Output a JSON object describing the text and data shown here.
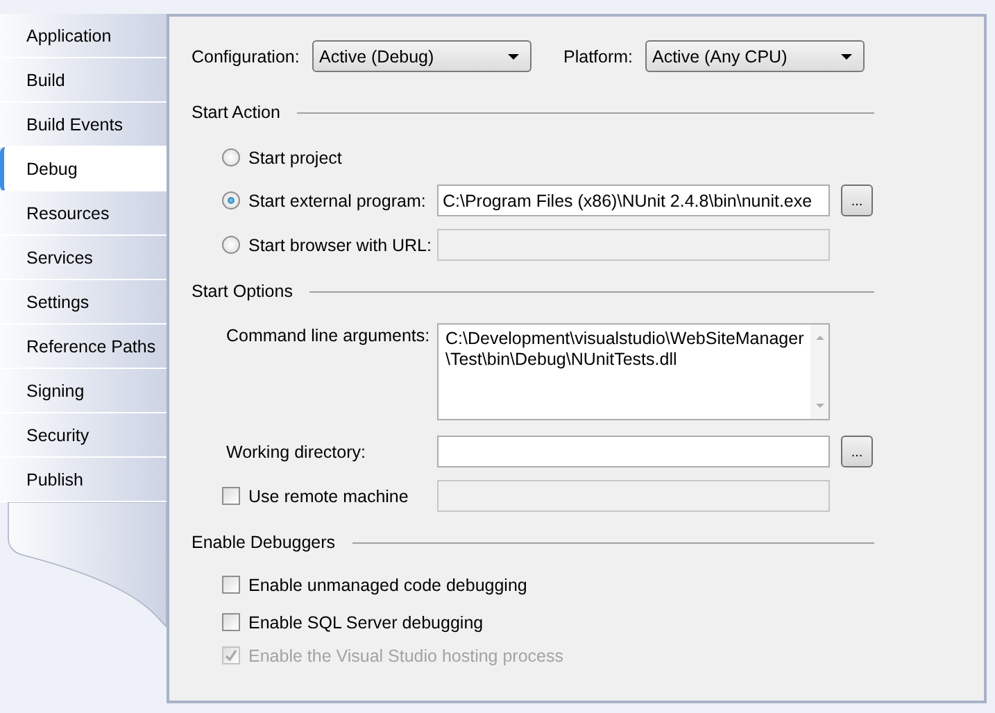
{
  "tabs": [
    {
      "label": "Application",
      "selected": false
    },
    {
      "label": "Build",
      "selected": false
    },
    {
      "label": "Build Events",
      "selected": false
    },
    {
      "label": "Debug",
      "selected": true
    },
    {
      "label": "Resources",
      "selected": false
    },
    {
      "label": "Services",
      "selected": false
    },
    {
      "label": "Settings",
      "selected": false
    },
    {
      "label": "Reference Paths",
      "selected": false
    },
    {
      "label": "Signing",
      "selected": false
    },
    {
      "label": "Security",
      "selected": false
    },
    {
      "label": "Publish",
      "selected": false
    }
  ],
  "configuration": {
    "label": "Configuration:",
    "value": "Active (Debug)"
  },
  "platform": {
    "label": "Platform:",
    "value": "Active (Any CPU)"
  },
  "start_action": {
    "heading": "Start Action",
    "options": [
      {
        "label": "Start project",
        "selected": false
      },
      {
        "label": "Start external program:",
        "selected": true,
        "field": {
          "value": "C:\\Program Files (x86)\\NUnit 2.4.8\\bin\\nunit.exe",
          "disabled": false
        },
        "browse_button": "..."
      },
      {
        "label": "Start browser with URL:",
        "selected": false,
        "field": {
          "disabled": true
        }
      }
    ]
  },
  "start_options": {
    "heading": "Start Options",
    "command_line": {
      "label": "Command line arguments:",
      "lines": [
        "C:\\Development\\visualstudio\\WebSiteManager",
        "\\Test\\bin\\Debug\\NUnitTests.dll"
      ]
    },
    "working_directory": {
      "label": "Working directory:",
      "field": {
        "disabled": false
      },
      "browse_button": "..."
    },
    "remote_machine": {
      "label": "Use remote machine",
      "checked": false,
      "field": {
        "disabled": true
      }
    }
  },
  "enable_debuggers": {
    "heading": "Enable Debuggers",
    "items": [
      {
        "label": "Enable unmanaged code debugging",
        "checked": false,
        "disabled": false
      },
      {
        "label": "Enable SQL Server debugging",
        "checked": false,
        "disabled": false
      },
      {
        "label": "Enable the Visual Studio hosting process",
        "checked": true,
        "disabled": true
      }
    ]
  }
}
